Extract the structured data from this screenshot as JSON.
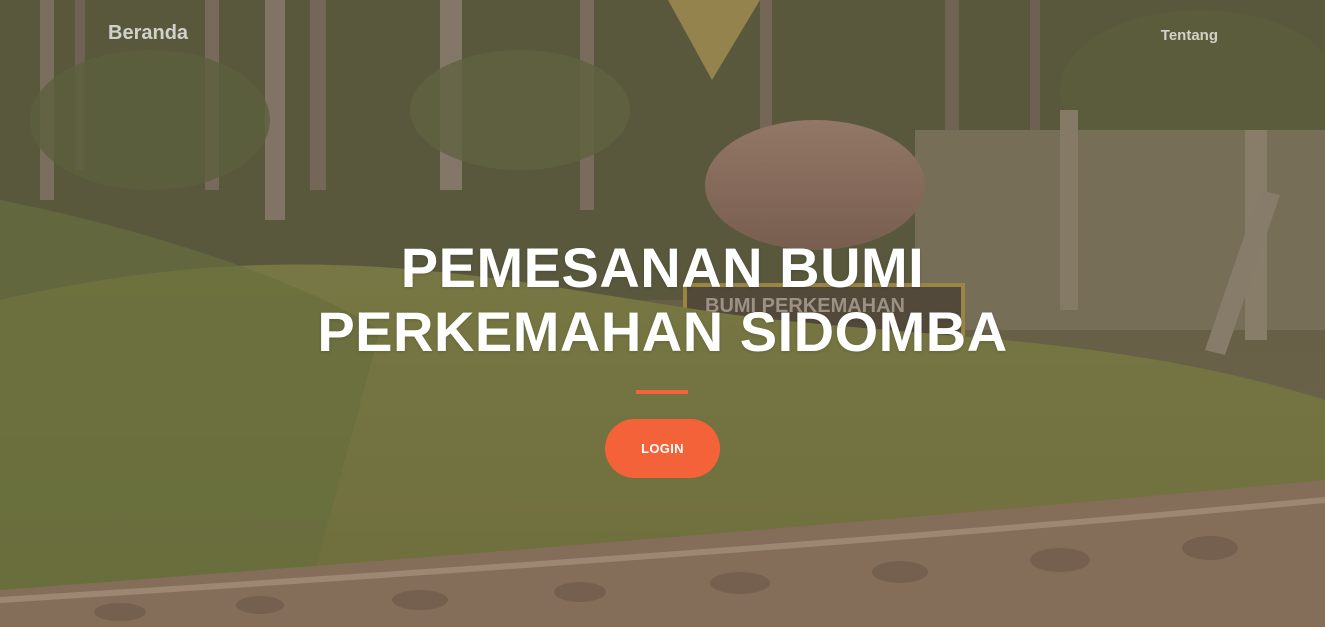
{
  "navbar": {
    "brand": "Beranda",
    "links": [
      {
        "label": "Tentang"
      }
    ]
  },
  "hero": {
    "title_line1": "PEMESANAN BUMI",
    "title_line2": "PERKEMAHAN SIDOMBA",
    "cta_label": "LOGIN",
    "background_sign_text": "BUMI PERKEMAHAN"
  },
  "colors": {
    "accent": "#f4623a",
    "overlay": "rgba(92,72,60,0.42)",
    "text": "#ffffff"
  },
  "icons": []
}
